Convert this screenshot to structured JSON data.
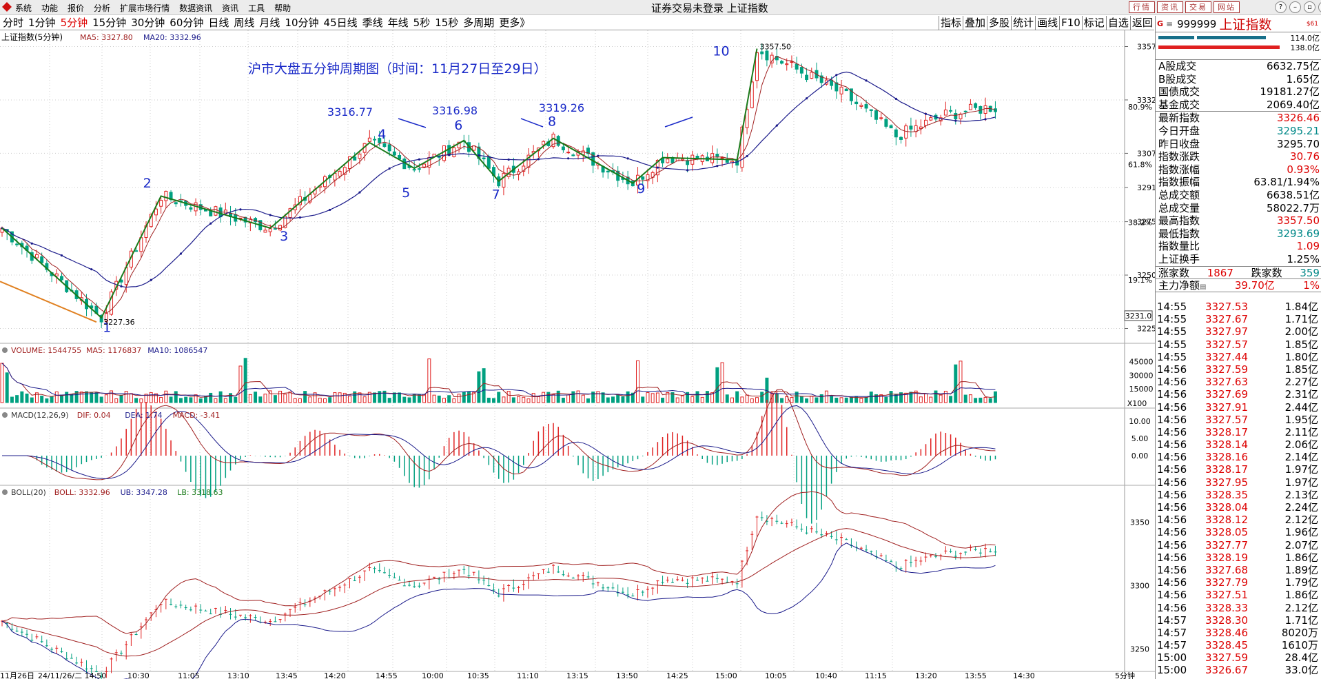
{
  "window": {
    "title": "证券交易未登录 上证指数",
    "menu": [
      "系统",
      "功能",
      "报价",
      "分析",
      "扩展市场行情",
      "数据资讯",
      "资讯",
      "工具",
      "帮助"
    ],
    "ext_buttons": [
      "行情",
      "资讯",
      "交易",
      "网站"
    ],
    "win_buttons": [
      "?",
      "–",
      "▫",
      "×"
    ]
  },
  "period_tabs": [
    "分时",
    "1分钟",
    "5分钟",
    "15分钟",
    "30分钟",
    "60分钟",
    "日线",
    "周线",
    "月线",
    "10分钟",
    "45日线",
    "季线",
    "年线",
    "5秒",
    "15秒",
    "多周期",
    "更多》"
  ],
  "active_period": "5分钟",
  "tool_buttons": [
    "指标",
    "叠加",
    "多股",
    "统计",
    "画线",
    "F10",
    "标记",
    "自选",
    "返回"
  ],
  "main_panel": {
    "label": "上证指数(5分钟)",
    "ma5": "MA5: 3327.80",
    "ma20": "MA20: 3332.96",
    "annotation_title": "沪市大盘五分钟周期图（时间：11月27日至29日）",
    "wave_labels": [
      "1",
      "2",
      "3",
      "4",
      "5",
      "6",
      "7",
      "8",
      "9",
      "10"
    ],
    "callouts": [
      "3316.77",
      "3316.98",
      "3319.26"
    ],
    "low_label": "3227.36",
    "high_label": "3357.50",
    "y_ticks": [
      "3357",
      "3332",
      "3307",
      "3291",
      "3275",
      "3250",
      "3225"
    ],
    "pct_ticks": [
      "80.9%",
      "61.8%",
      "38.2%",
      "19.1%"
    ],
    "cursor_box": "3231.0"
  },
  "volume_panel": {
    "label": "VOLUME: 1544755",
    "ma5": "MA5: 1176837",
    "ma10": "MA10: 1086547",
    "y_ticks": [
      "45000",
      "30000",
      "15000"
    ],
    "unit": "X100"
  },
  "macd_panel": {
    "label": "MACD(12,26,9)",
    "dif": "DIF: 0.04",
    "dea": "DEA: 1.74",
    "macd": "MACD: -3.41",
    "y_ticks": [
      "10.00",
      "5.00",
      "0.00"
    ]
  },
  "boll_panel": {
    "label": "BOLL(20)",
    "boll": "BOLL: 3332.96",
    "ub": "UB: 3347.28",
    "lb": "LB: 3318.63",
    "y_ticks": [
      "3350",
      "3300",
      "3250"
    ]
  },
  "x_axis": [
    "11月26日",
    "24/11/26/二 14:50",
    "10:30",
    "11:05",
    "13:10",
    "13:45",
    "14:20",
    "14:55",
    "10:00",
    "10:35",
    "11:10",
    "13:15",
    "13:50",
    "14:25",
    "15:00",
    "10:05",
    "10:40",
    "11:15",
    "13:20",
    "13:55",
    "14:30",
    "5分钟"
  ],
  "right_panel": {
    "code": "999999",
    "name": "上证指数",
    "g": "G",
    "sb": "$61",
    "bar_val1": "114.0亿",
    "bar_val2": "138.0亿",
    "stats1": [
      [
        "A股成交",
        "6632.75亿",
        "black"
      ],
      [
        "B股成交",
        "1.65亿",
        "black"
      ],
      [
        "国债成交",
        "19181.27亿",
        "black"
      ],
      [
        "基金成交",
        "2069.40亿",
        "black"
      ]
    ],
    "stats2": [
      [
        "最新指数",
        "3326.46",
        "red"
      ],
      [
        "今日开盘",
        "3295.21",
        "green"
      ],
      [
        "昨日收盘",
        "3295.70",
        "black"
      ],
      [
        "指数涨跌",
        "30.76",
        "red"
      ],
      [
        "指数涨幅",
        "0.93%",
        "red"
      ],
      [
        "指数振幅",
        "63.81/1.94%",
        "black"
      ],
      [
        "总成交额",
        "6638.51亿",
        "black"
      ],
      [
        "总成交量",
        "58022.7万",
        "black"
      ],
      [
        "最高指数",
        "3357.50",
        "red"
      ],
      [
        "最低指数",
        "3293.69",
        "green"
      ],
      [
        "指数量比",
        "1.09",
        "red"
      ],
      [
        "上证换手",
        "1.25%",
        "black"
      ]
    ],
    "rise_label": "涨家数",
    "rise": "1867",
    "fall_label": "跌家数",
    "fall": "359",
    "net_label": "主力净额",
    "net": "39.70亿",
    "net_pct": "1%",
    "trades": [
      [
        "14:55",
        "3327.53",
        "1.84亿"
      ],
      [
        "14:55",
        "3327.67",
        "1.71亿"
      ],
      [
        "14:55",
        "3327.97",
        "2.00亿"
      ],
      [
        "14:55",
        "3327.57",
        "1.85亿"
      ],
      [
        "14:55",
        "3327.44",
        "1.80亿"
      ],
      [
        "14:56",
        "3327.59",
        "1.85亿"
      ],
      [
        "14:56",
        "3327.63",
        "2.27亿"
      ],
      [
        "14:56",
        "3327.69",
        "2.31亿"
      ],
      [
        "14:56",
        "3327.91",
        "2.44亿"
      ],
      [
        "14:56",
        "3327.57",
        "1.95亿"
      ],
      [
        "14:56",
        "3328.17",
        "2.11亿"
      ],
      [
        "14:56",
        "3328.14",
        "2.06亿"
      ],
      [
        "14:56",
        "3328.16",
        "2.14亿"
      ],
      [
        "14:56",
        "3328.17",
        "1.97亿"
      ],
      [
        "14:56",
        "3327.95",
        "1.97亿"
      ],
      [
        "14:56",
        "3328.35",
        "2.13亿"
      ],
      [
        "14:56",
        "3328.04",
        "2.24亿"
      ],
      [
        "14:56",
        "3328.12",
        "2.12亿"
      ],
      [
        "14:56",
        "3328.05",
        "1.96亿"
      ],
      [
        "14:56",
        "3327.77",
        "2.07亿"
      ],
      [
        "14:56",
        "3328.19",
        "1.86亿"
      ],
      [
        "14:56",
        "3327.68",
        "1.89亿"
      ],
      [
        "14:56",
        "3327.79",
        "1.79亿"
      ],
      [
        "14:56",
        "3327.51",
        "1.86亿"
      ],
      [
        "14:56",
        "3328.33",
        "2.12亿"
      ],
      [
        "14:57",
        "3328.30",
        "1.71亿"
      ],
      [
        "14:57",
        "3328.46",
        "8020万"
      ],
      [
        "14:57",
        "3328.45",
        "1610万"
      ],
      [
        "15:00",
        "3327.59",
        "28.4亿"
      ],
      [
        "15:00",
        "3326.67",
        "33.0亿"
      ]
    ]
  },
  "colors": {
    "up": "#e02020",
    "down": "#00a080",
    "ma5": "#a02020",
    "ma20": "#1a1a8a",
    "wave": "#1a7a1a",
    "annot": "#1a2ac8",
    "trend": "#e08020"
  }
}
